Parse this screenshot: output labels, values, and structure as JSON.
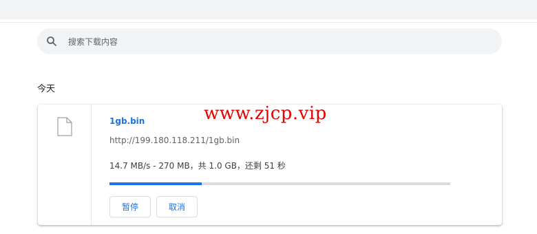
{
  "search": {
    "placeholder": "搜索下载内容"
  },
  "date_header": "今天",
  "download": {
    "filename": "1gb.bin",
    "url": "http://199.180.118.211/1gb.bin",
    "status": "14.7 MB/s - 270 MB，共 1.0 GB，还剩 51 秒",
    "progress_fraction": 0.27,
    "pause_label": "暂停",
    "cancel_label": "取消"
  },
  "watermark": "www.zjcp.vip",
  "colors": {
    "accent": "#1a73e8",
    "watermark": "#e60000",
    "search_bg": "#f1f3f4"
  },
  "icons": {
    "search": "search-icon",
    "file": "file-icon"
  }
}
